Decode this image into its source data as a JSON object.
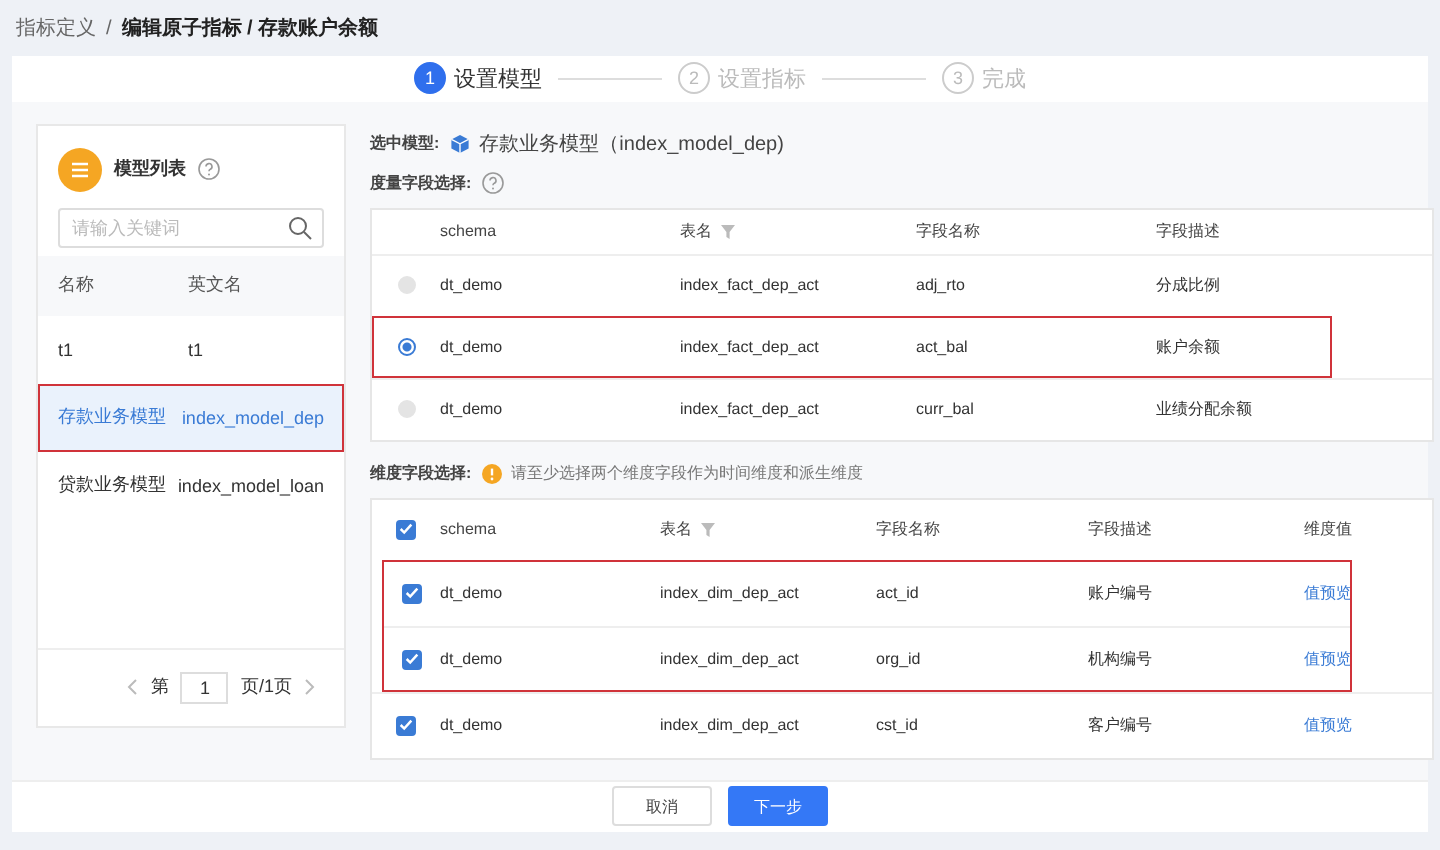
{
  "breadcrumb": {
    "separator": "/",
    "items": [
      {
        "label": "指标定义",
        "current": false
      },
      {
        "label": "编辑原子指标 / 存款账户余额",
        "current": true
      }
    ]
  },
  "steps": [
    {
      "number": "1",
      "label": "设置模型",
      "selected": true
    },
    {
      "number": "2",
      "label": "设置指标",
      "selected": false
    },
    {
      "number": "3",
      "label": "完成",
      "selected": false
    }
  ],
  "model_list": {
    "title": "模型列表",
    "search": {
      "placeholder": "请输入关键词"
    },
    "columns": [
      "名称",
      "英文名"
    ],
    "rows": [
      {
        "name": "t1",
        "english_name": "t1",
        "selected": false,
        "marked": false
      },
      {
        "name": "存款业务模型",
        "english_name": "index_model_dep",
        "selected": true,
        "marked": true
      },
      {
        "name": "贷款业务模型",
        "english_name": "index_model_loan",
        "selected": false,
        "marked": false
      }
    ],
    "pager": {
      "prefix": "第",
      "page": "1",
      "suffix": "页/1页"
    }
  },
  "selected_model": {
    "label": "选中模型:",
    "value": "存款业务模型（index_model_dep)"
  },
  "measure": {
    "label": "度量字段选择:",
    "columns": [
      "schema",
      "表名",
      "字段名称",
      "字段描述"
    ],
    "rows": [
      {
        "schema": "dt_demo",
        "table": "index_fact_dep_act",
        "field": "adj_rto",
        "description": "分成比例",
        "selected": false,
        "disabled": true,
        "marked": false
      },
      {
        "schema": "dt_demo",
        "table": "index_fact_dep_act",
        "field": "act_bal",
        "description": "账户余额",
        "selected": true,
        "disabled": false,
        "marked": true
      },
      {
        "schema": "dt_demo",
        "table": "index_fact_dep_act",
        "field": "curr_bal",
        "description": "业绩分配余额",
        "selected": false,
        "disabled": true,
        "marked": false
      }
    ]
  },
  "dimension": {
    "label": "维度字段选择:",
    "hint": "请至少选择两个维度字段作为时间维度和派生维度",
    "all_checked": true,
    "columns": [
      "schema",
      "表名",
      "字段名称",
      "字段描述",
      "维度值"
    ],
    "rows": [
      {
        "schema": "dt_demo",
        "table": "index_dim_dep_act",
        "field": "act_id",
        "description": "账户编号",
        "link": "值预览",
        "checked": true,
        "marked": true
      },
      {
        "schema": "dt_demo",
        "table": "index_dim_dep_act",
        "field": "org_id",
        "description": "机构编号",
        "link": "值预览",
        "checked": true,
        "marked": true
      },
      {
        "schema": "dt_demo",
        "table": "index_dim_dep_act",
        "field": "cst_id",
        "description": "客户编号",
        "link": "值预览",
        "checked": true,
        "marked": false
      }
    ]
  },
  "buttons": [
    {
      "label": "取消",
      "kind": "default"
    },
    {
      "label": "下一步",
      "kind": "primary"
    }
  ]
}
